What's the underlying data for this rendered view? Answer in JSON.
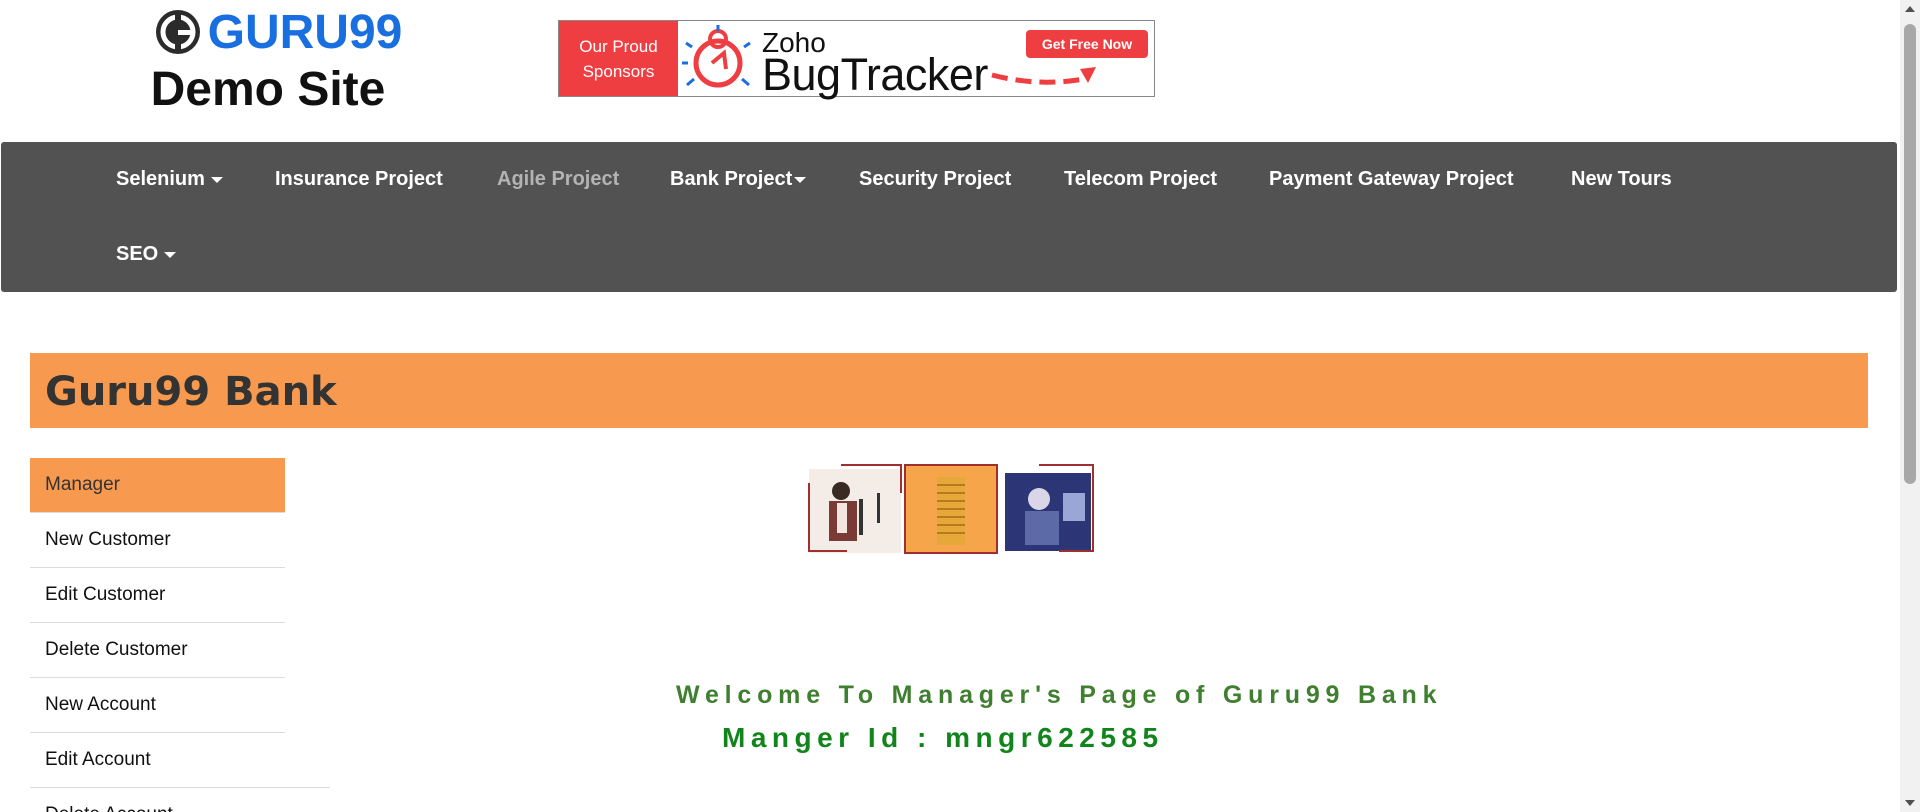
{
  "header": {
    "brand": "GURU99",
    "subtitle": "Demo Site",
    "sponsor": {
      "left_line1": "Our Proud",
      "left_line2": "Sponsors",
      "zoho": "Zoho",
      "product": "BugTracker",
      "cta": "Get Free Now"
    }
  },
  "nav": {
    "items": [
      {
        "label": "Selenium",
        "dropdown": true
      },
      {
        "label": "Insurance Project",
        "dropdown": false
      },
      {
        "label": "Agile Project",
        "dropdown": false,
        "muted": true
      },
      {
        "label": "Bank Project",
        "dropdown": true
      },
      {
        "label": "Security Project",
        "dropdown": false
      },
      {
        "label": "Telecom Project",
        "dropdown": false
      },
      {
        "label": "Payment Gateway Project",
        "dropdown": false
      },
      {
        "label": "New Tours",
        "dropdown": false
      },
      {
        "label": "SEO",
        "dropdown": true
      }
    ]
  },
  "bank": {
    "title": "Guru99 Bank"
  },
  "menu": {
    "items": [
      {
        "label": "Manager"
      },
      {
        "label": "New Customer"
      },
      {
        "label": "Edit Customer"
      },
      {
        "label": "Delete Customer"
      },
      {
        "label": "New Account"
      },
      {
        "label": "Edit Account"
      },
      {
        "label": "Delete Account"
      }
    ]
  },
  "main": {
    "welcome": "Welcome To Manager's Page of Guru99 Bank",
    "manager_id": "Manger Id : mngr622585"
  },
  "colors": {
    "accent": "#f79a50",
    "nav_bg": "#525252",
    "brand_blue": "#1a6fe0",
    "welcome_green": "#3f7f2f"
  }
}
